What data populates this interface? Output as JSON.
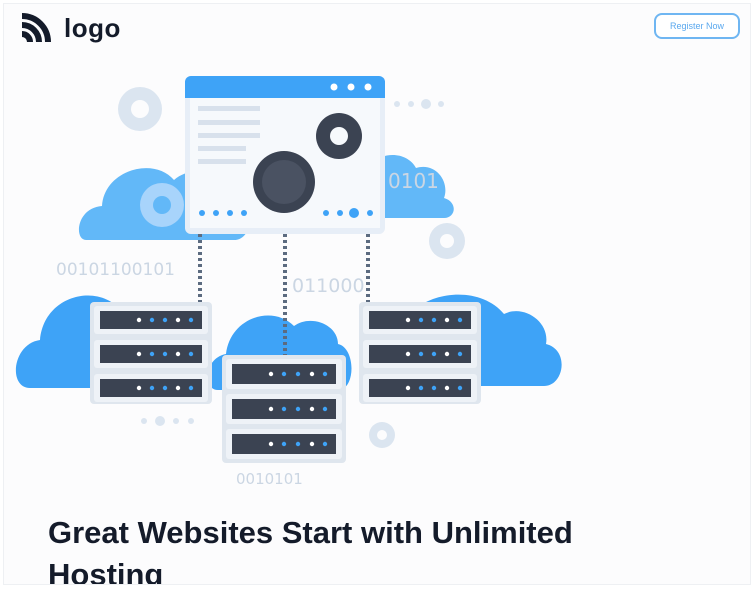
{
  "header": {
    "logo_text": "logo",
    "register_label": "Register Now"
  },
  "illustration": {
    "binary_top_right": "0101",
    "binary_left": "00101100101",
    "binary_center": "011000",
    "binary_bottom": "0010101"
  },
  "hero": {
    "headline": "Great Websites Start with Unlimited Hosting"
  },
  "colors": {
    "accent": "#5aa8ee",
    "cloud_blue": "#3ea3f7",
    "dark_navy": "#141b2a",
    "server_dark": "#3b4352"
  }
}
